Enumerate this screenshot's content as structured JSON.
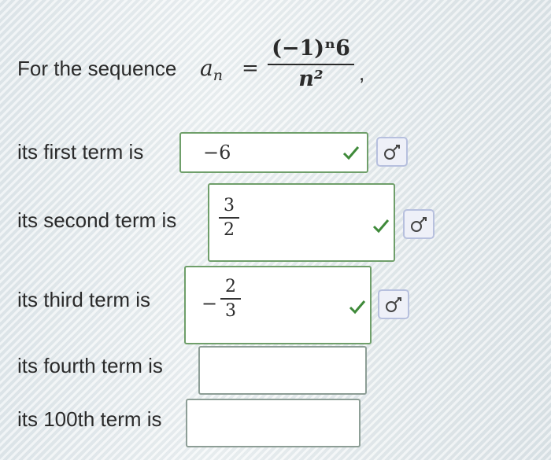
{
  "prompt": {
    "prefix": "For the sequence",
    "var": "a",
    "sub": "n",
    "equals": "=",
    "numerator": "(−1)ⁿ6",
    "denominator": "n²",
    "suffix": ","
  },
  "rows": [
    {
      "label": "its first term is",
      "value": "−6",
      "correct": true
    },
    {
      "label": "its second term is",
      "num": "3",
      "den": "2",
      "sign": "",
      "correct": true
    },
    {
      "label": "its third term is",
      "num": "2",
      "den": "3",
      "sign": "−",
      "correct": true
    },
    {
      "label": "its fourth term is",
      "value": "",
      "correct": false
    },
    {
      "label": "its 100th term is",
      "value": "",
      "correct": false
    }
  ],
  "icons": {
    "check": "checkmark-icon",
    "keypad": "math-keypad-icon"
  },
  "colors": {
    "check": "#3f8a3a",
    "box_ok": "#6f9f6a",
    "key_border": "#b7c0de"
  }
}
